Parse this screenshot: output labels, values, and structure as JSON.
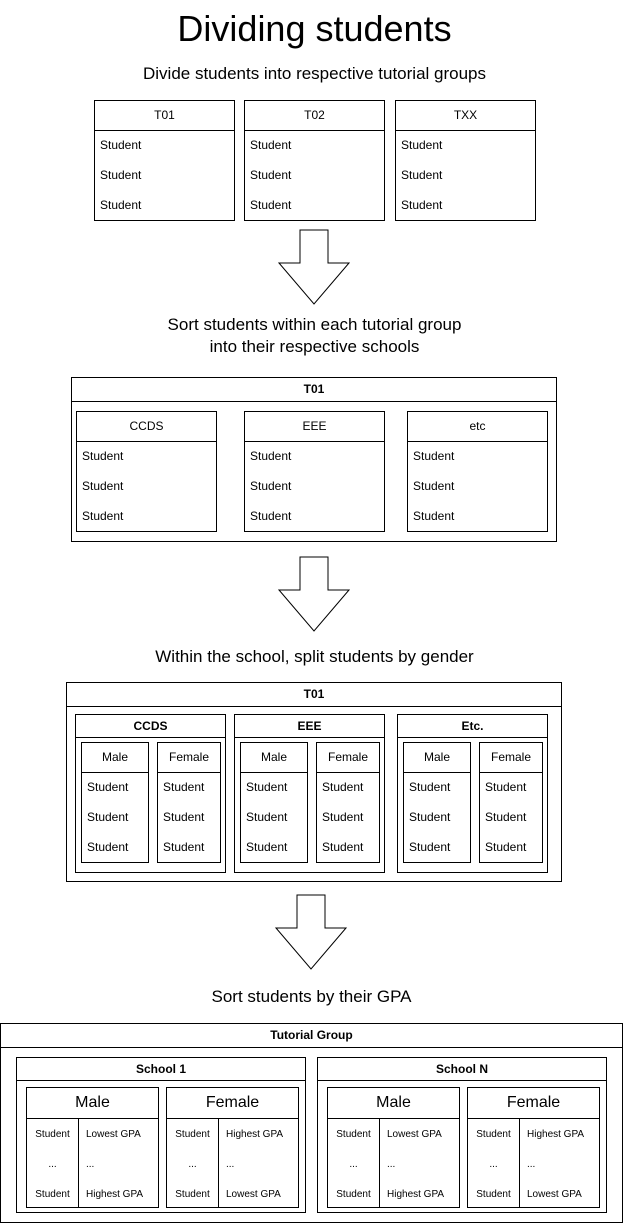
{
  "title": "Dividing students",
  "student": "Student",
  "ellipsis": "...",
  "step1": {
    "heading": "Divide students into respective tutorial groups",
    "groups": [
      "T01",
      "T02",
      "TXX"
    ]
  },
  "step2": {
    "heading_line1": "Sort students within each tutorial group",
    "heading_line2": "into their respective schools",
    "group": "T01",
    "schools": [
      "CCDS",
      "EEE",
      "etc"
    ]
  },
  "step3": {
    "heading": "Within the school, split students by gender",
    "group": "T01",
    "schools": [
      "CCDS",
      "EEE",
      "Etc."
    ],
    "male": "Male",
    "female": "Female"
  },
  "step4": {
    "heading": "Sort students by their GPA",
    "group": "Tutorial Group",
    "schools": [
      "School 1",
      "School N"
    ],
    "male": "Male",
    "female": "Female",
    "lowest": "Lowest GPA",
    "highest": "Highest GPA"
  }
}
